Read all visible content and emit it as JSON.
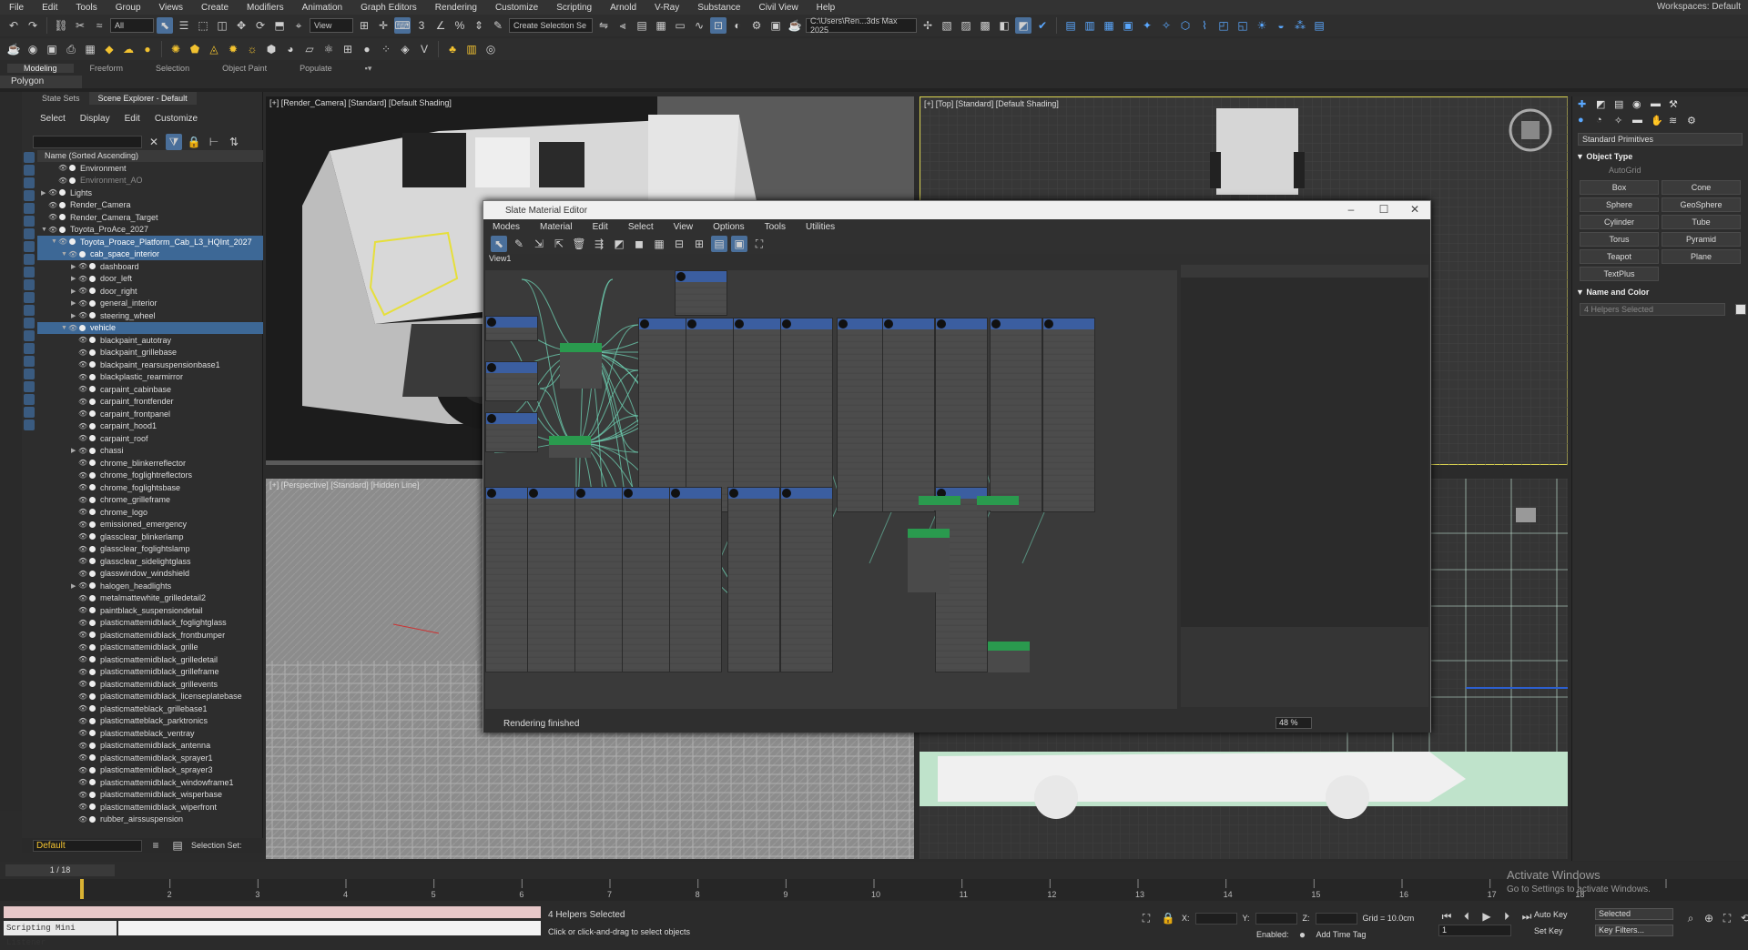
{
  "menubar": {
    "items": [
      "File",
      "Edit",
      "Tools",
      "Group",
      "Views",
      "Create",
      "Modifiers",
      "Animation",
      "Graph Editors",
      "Rendering",
      "Customize",
      "Scripting",
      "Arnold",
      "V-Ray",
      "Substance",
      "Civil View",
      "Help"
    ],
    "workspace": "Workspaces:  Default"
  },
  "toolbar": {
    "selection_filter": "All",
    "ref_coord": "View",
    "selection_set": "Create Selection Se",
    "project_path": "C:\\Users\\Ren...3ds Max 2025"
  },
  "ribbon": {
    "tabs": [
      "Modeling",
      "Freeform",
      "Selection",
      "Object Paint",
      "Populate"
    ],
    "active": "Modeling",
    "sub": "Polygon Modeling"
  },
  "explorer": {
    "tabs": [
      "State Sets",
      "Scene Explorer - Default"
    ],
    "menu": [
      "Select",
      "Display",
      "Edit",
      "Customize"
    ],
    "header": "Name (Sorted Ascending)",
    "rows": [
      {
        "indent": 1,
        "label": "Environment",
        "exp": ""
      },
      {
        "indent": 1,
        "label": "Environment_AO",
        "exp": "",
        "dim": true
      },
      {
        "indent": 0,
        "label": "Lights",
        "exp": "▶"
      },
      {
        "indent": 0,
        "label": "Render_Camera",
        "exp": ""
      },
      {
        "indent": 0,
        "label": "Render_Camera_Target",
        "exp": ""
      },
      {
        "indent": 0,
        "label": "Toyota_ProAce_2027",
        "exp": "▼"
      },
      {
        "indent": 1,
        "label": "Toyota_Proace_Platform_Cab_L3_HQInt_2027",
        "exp": "▼",
        "sel": true
      },
      {
        "indent": 2,
        "label": "cab_space_interior",
        "exp": "▼",
        "sel": true
      },
      {
        "indent": 3,
        "label": "dashboard",
        "exp": "▶"
      },
      {
        "indent": 3,
        "label": "door_left",
        "exp": "▶"
      },
      {
        "indent": 3,
        "label": "door_right",
        "exp": "▶"
      },
      {
        "indent": 3,
        "label": "general_interior",
        "exp": "▶"
      },
      {
        "indent": 3,
        "label": "steering_wheel",
        "exp": "▶"
      },
      {
        "indent": 2,
        "label": "vehicle",
        "exp": "▼",
        "sel": true
      },
      {
        "indent": 3,
        "label": "blackpaint_autotray",
        "exp": ""
      },
      {
        "indent": 3,
        "label": "blackpaint_grillebase",
        "exp": ""
      },
      {
        "indent": 3,
        "label": "blackpaint_rearsuspensionbase1",
        "exp": ""
      },
      {
        "indent": 3,
        "label": "blackplastic_rearmirror",
        "exp": ""
      },
      {
        "indent": 3,
        "label": "carpaint_cabinbase",
        "exp": ""
      },
      {
        "indent": 3,
        "label": "carpaint_frontfender",
        "exp": ""
      },
      {
        "indent": 3,
        "label": "carpaint_frontpanel",
        "exp": ""
      },
      {
        "indent": 3,
        "label": "carpaint_hood1",
        "exp": ""
      },
      {
        "indent": 3,
        "label": "carpaint_roof",
        "exp": ""
      },
      {
        "indent": 3,
        "label": "chassi",
        "exp": "▶"
      },
      {
        "indent": 3,
        "label": "chrome_blinkerreflector",
        "exp": ""
      },
      {
        "indent": 3,
        "label": "chrome_foglightreflectors",
        "exp": ""
      },
      {
        "indent": 3,
        "label": "chrome_foglightsbase",
        "exp": ""
      },
      {
        "indent": 3,
        "label": "chrome_grilleframe",
        "exp": ""
      },
      {
        "indent": 3,
        "label": "chrome_logo",
        "exp": ""
      },
      {
        "indent": 3,
        "label": "emissioned_emergency",
        "exp": ""
      },
      {
        "indent": 3,
        "label": "glassclear_blinkerlamp",
        "exp": ""
      },
      {
        "indent": 3,
        "label": "glassclear_foglightslamp",
        "exp": ""
      },
      {
        "indent": 3,
        "label": "glassclear_sidelightglass",
        "exp": ""
      },
      {
        "indent": 3,
        "label": "glasswindow_windshield",
        "exp": ""
      },
      {
        "indent": 3,
        "label": "halogen_headlights",
        "exp": "▶"
      },
      {
        "indent": 3,
        "label": "metalmattewhite_grilledetail2",
        "exp": ""
      },
      {
        "indent": 3,
        "label": "paintblack_suspensiondetail",
        "exp": ""
      },
      {
        "indent": 3,
        "label": "plasticmattemidblack_foglightglass",
        "exp": ""
      },
      {
        "indent": 3,
        "label": "plasticmattemidblack_frontbumper",
        "exp": ""
      },
      {
        "indent": 3,
        "label": "plasticmattemidblack_grille",
        "exp": ""
      },
      {
        "indent": 3,
        "label": "plasticmattemidblack_grilledetail",
        "exp": ""
      },
      {
        "indent": 3,
        "label": "plasticmattemidblack_grilleframe",
        "exp": ""
      },
      {
        "indent": 3,
        "label": "plasticmattemidblack_grillevents",
        "exp": ""
      },
      {
        "indent": 3,
        "label": "plasticmattemidblack_licenseplatebase",
        "exp": ""
      },
      {
        "indent": 3,
        "label": "plasticmatteblack_grillebase1",
        "exp": ""
      },
      {
        "indent": 3,
        "label": "plasticmatteblack_parktronics",
        "exp": ""
      },
      {
        "indent": 3,
        "label": "plasticmatteblack_ventray",
        "exp": ""
      },
      {
        "indent": 3,
        "label": "plasticmattemidblack_antenna",
        "exp": ""
      },
      {
        "indent": 3,
        "label": "plasticmattemidblack_sprayer1",
        "exp": ""
      },
      {
        "indent": 3,
        "label": "plasticmattemidblack_sprayer3",
        "exp": ""
      },
      {
        "indent": 3,
        "label": "plasticmattemidblack_windowframe1",
        "exp": ""
      },
      {
        "indent": 3,
        "label": "plasticmattemidblack_wisperbase",
        "exp": ""
      },
      {
        "indent": 3,
        "label": "plasticmattemidblack_wiperfront",
        "exp": ""
      },
      {
        "indent": 3,
        "label": "rubber_airssuspension",
        "exp": ""
      }
    ],
    "layer": "Default",
    "selection_set_label": "Selection Set:"
  },
  "viewports": {
    "camera": "[+] [Render_Camera] [Standard] [Default Shading]",
    "top": "[+] [Top] [Standard] [Default Shading]",
    "persp": "[+] [Perspective] [Standard] [Hidden Line]"
  },
  "command_panel": {
    "category": "Standard Primitives",
    "object_type": "Object Type",
    "autogrid": "AutoGrid",
    "buttons": [
      "Box",
      "Cone",
      "Sphere",
      "GeoSphere",
      "Cylinder",
      "Tube",
      "Torus",
      "Pyramid",
      "Teapot",
      "Plane",
      "TextPlus"
    ],
    "name_color": "Name and Color",
    "name_value": "4 Helpers Selected"
  },
  "sme": {
    "title": "Slate Material Editor",
    "menu": [
      "Modes",
      "Material",
      "Edit",
      "Select",
      "View",
      "Options",
      "Tools",
      "Utilities"
    ],
    "view_tab": "View1",
    "status": "Rendering finished",
    "zoom": "48 %"
  },
  "timeline": {
    "slider": "1 / 18",
    "ticks": [
      "2",
      "3",
      "4",
      "5",
      "6",
      "7",
      "8",
      "9",
      "10",
      "11",
      "12",
      "13",
      "14",
      "15",
      "16",
      "17",
      "18"
    ]
  },
  "status": {
    "script_listener": "Scripting Mini Listener",
    "selected": "4 Helpers Selected",
    "prompt": "Click or click-and-drag to select objects",
    "x_label": "X:",
    "y_label": "Y:",
    "z_label": "Z:",
    "grid": "Grid = 10.0cm",
    "enabled": "Enabled:",
    "add_time_tag": "Add Time Tag",
    "auto_key": "Auto Key",
    "set_key": "Set Key",
    "key_mode": "Selected",
    "key_filters": "Key Filters...",
    "frame": "1"
  },
  "watermark": {
    "line1": "Activate Windows",
    "line2": "Go to Settings to activate Windows."
  },
  "colors": {
    "accent": "#3d6896",
    "selection_yellow": "#d9d250",
    "node_header": "#3b5ea0",
    "map_node": "#2a9a4e",
    "wire": "#6fd3b4"
  }
}
